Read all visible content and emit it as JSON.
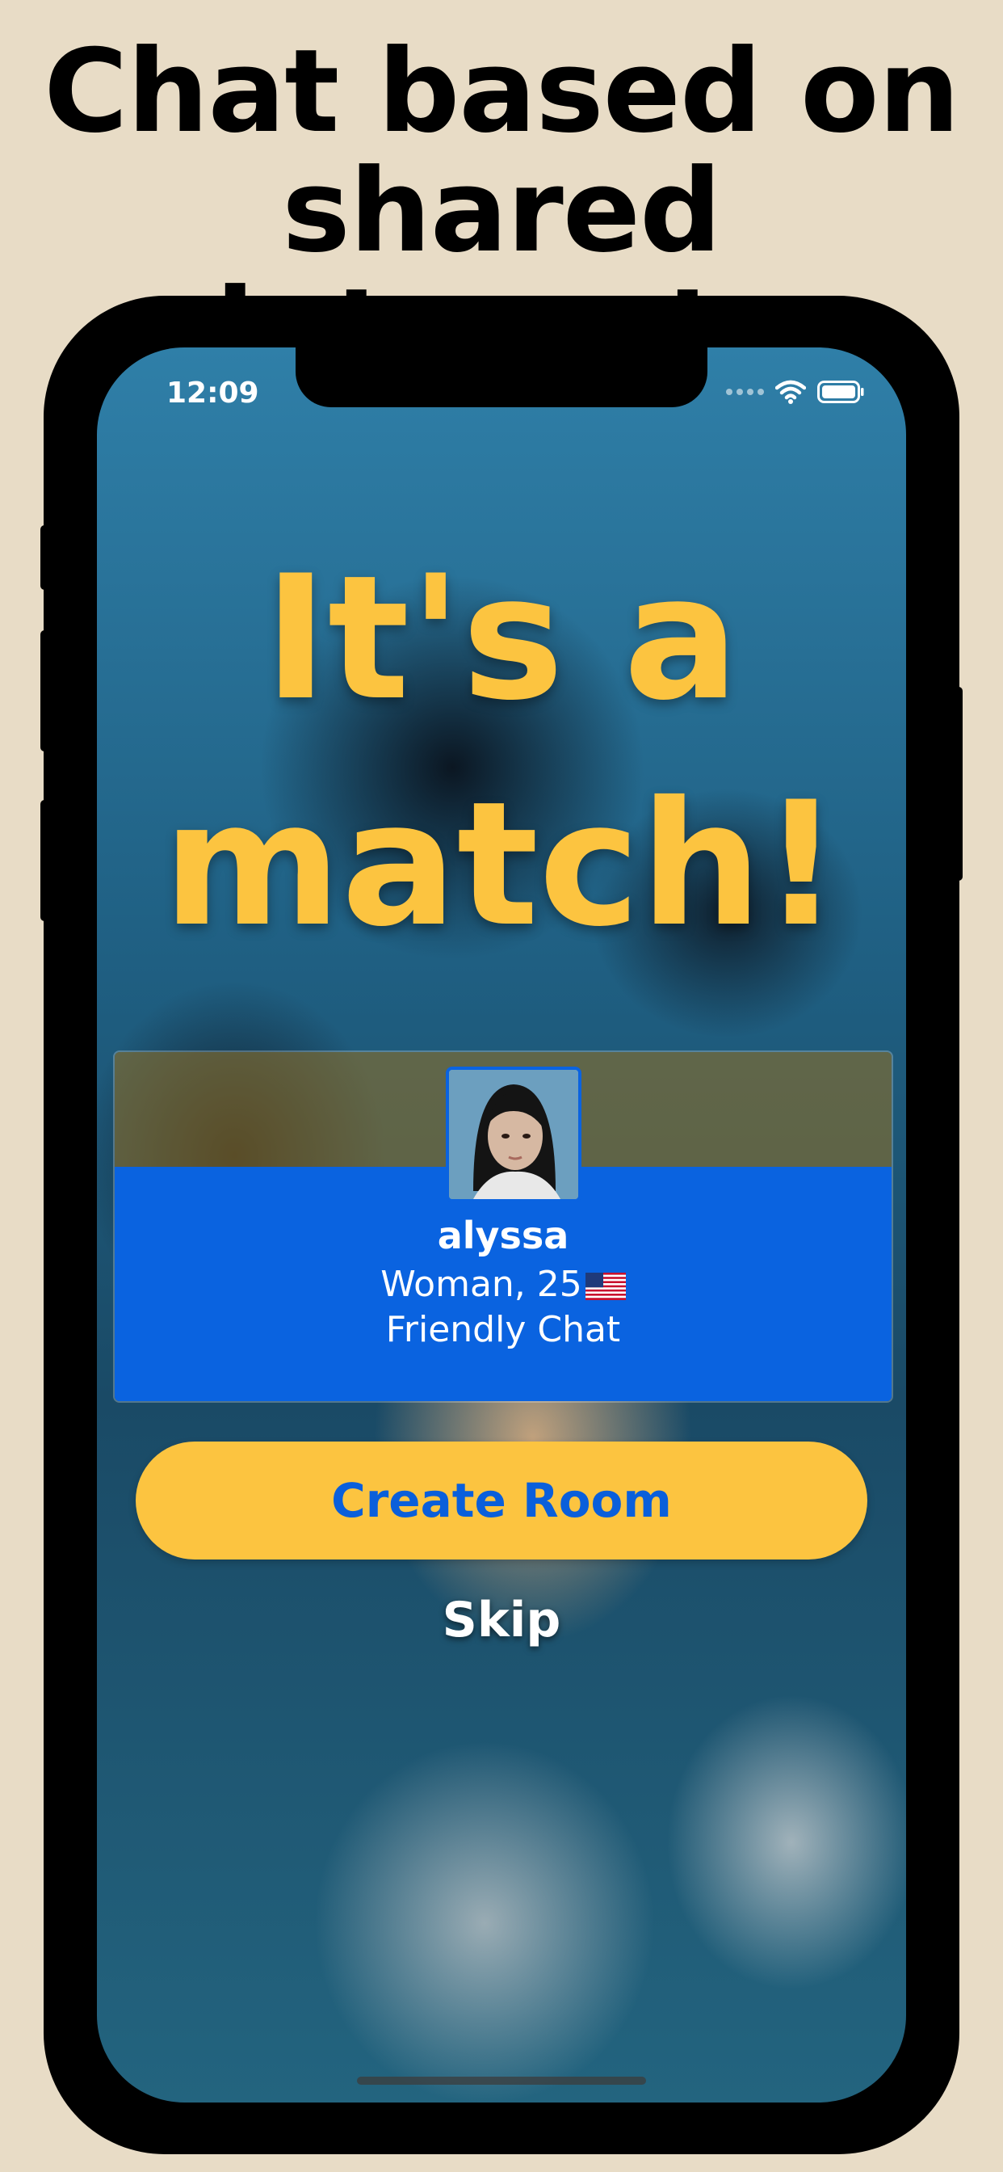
{
  "promo": {
    "headline_line1": "Chat based on",
    "headline_line2": "shared interests"
  },
  "status_bar": {
    "time": "12:09"
  },
  "match": {
    "title_line1": "It's a",
    "title_line2": "match!"
  },
  "profile_card": {
    "name": "alyssa",
    "details": "Woman, 25",
    "flag_icon": "us-flag-icon",
    "interest": "Friendly Chat"
  },
  "actions": {
    "create_room_label": "Create Room",
    "skip_label": "Skip"
  },
  "colors": {
    "accent_yellow": "#fcc440",
    "accent_blue": "#0a63e0",
    "page_background": "#e8dcc6"
  }
}
